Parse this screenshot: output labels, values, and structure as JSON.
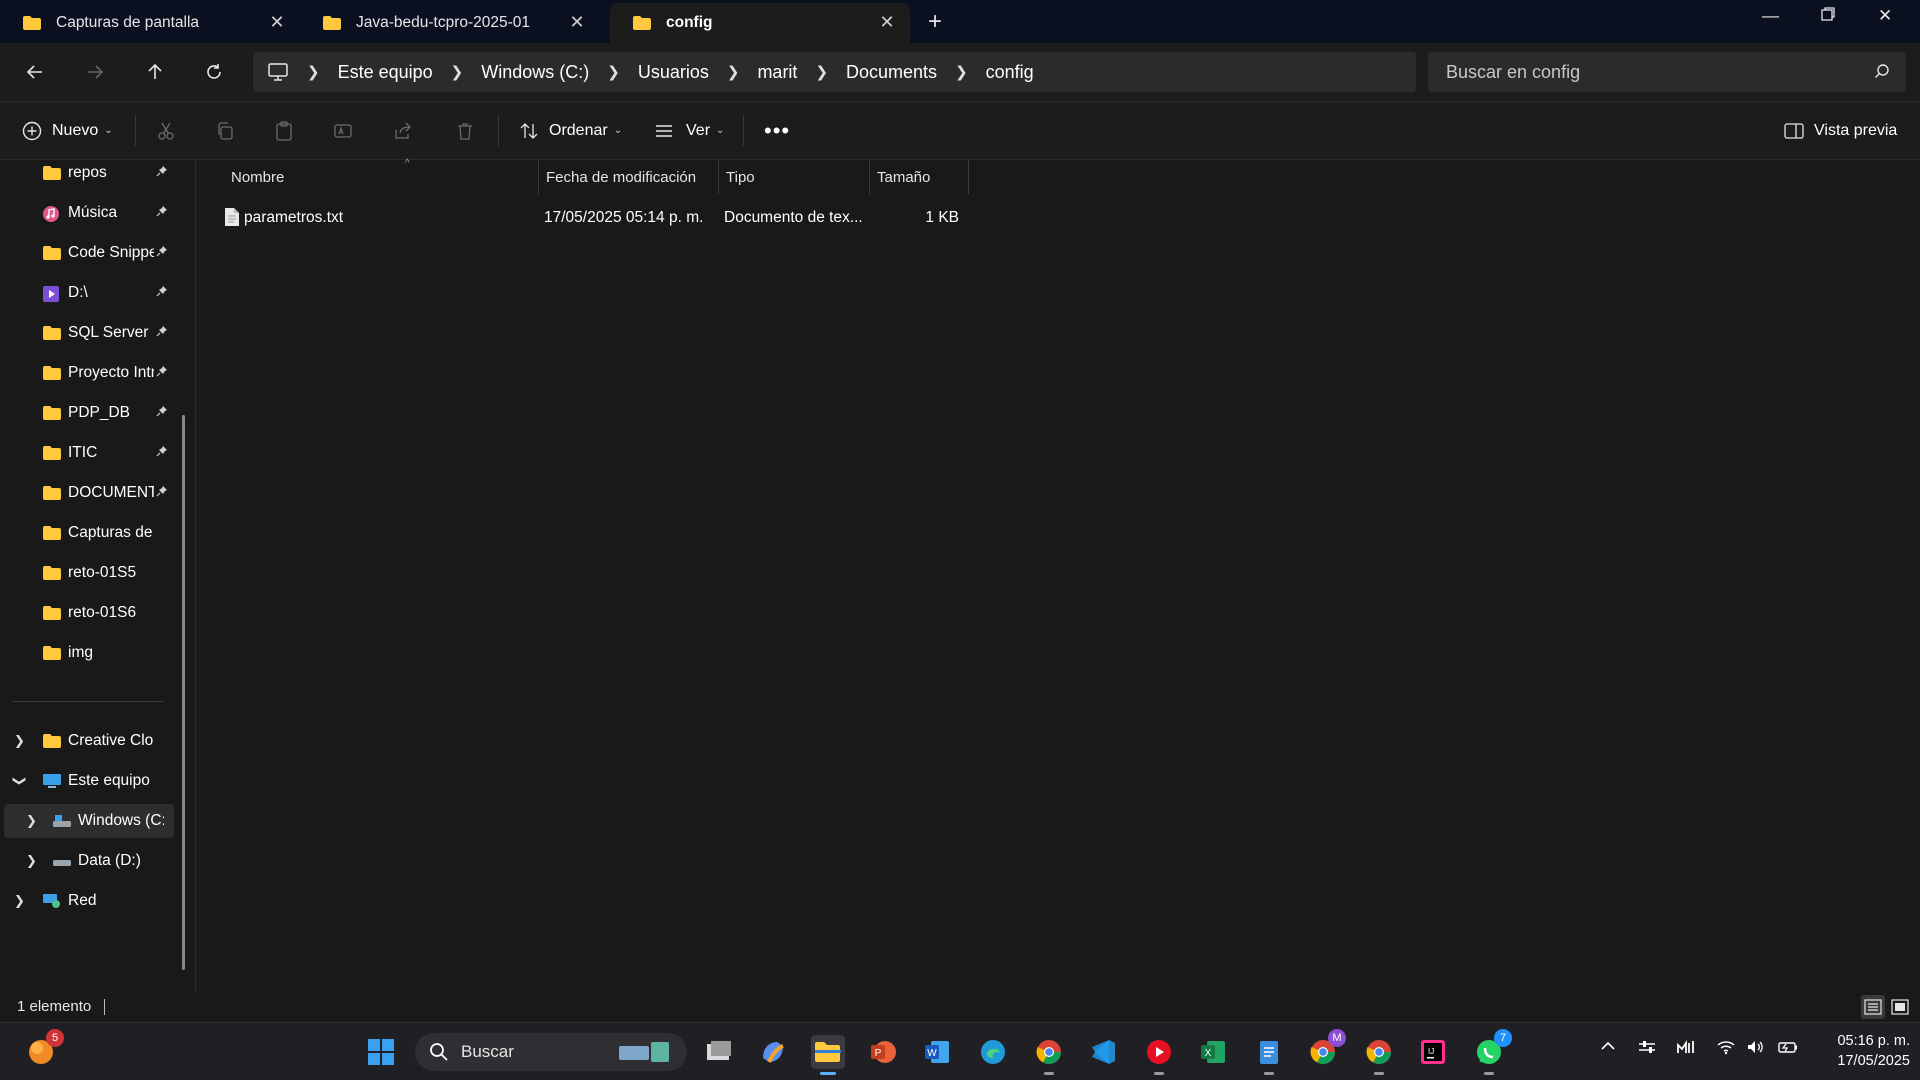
{
  "tabs": [
    {
      "label": "Capturas de pantalla"
    },
    {
      "label": "Java-bedu-tcpro-2025-01"
    },
    {
      "label": "config"
    }
  ],
  "breadcrumb": [
    "Este equipo",
    "Windows (C:)",
    "Usuarios",
    "marit",
    "Documents",
    "config"
  ],
  "search": {
    "placeholder": "Buscar en config"
  },
  "toolbar": {
    "new_label": "Nuevo",
    "sort_label": "Ordenar",
    "view_label": "Ver",
    "preview_label": "Vista previa"
  },
  "sidebar": {
    "quick_access": [
      {
        "label": "repos",
        "icon": "folder-icon",
        "pinned": true
      },
      {
        "label": "Música",
        "icon": "music-icon",
        "pinned": true
      },
      {
        "label": "Code Snippe",
        "icon": "folder-icon",
        "pinned": true
      },
      {
        "label": "D:\\",
        "icon": "video-drive-icon",
        "pinned": true
      },
      {
        "label": "SQL Server M",
        "icon": "folder-icon",
        "pinned": true
      },
      {
        "label": "Proyecto Intr",
        "icon": "folder-icon",
        "pinned": true
      },
      {
        "label": "PDP_DB",
        "icon": "folder-icon",
        "pinned": true
      },
      {
        "label": "ITIC",
        "icon": "folder-icon",
        "pinned": true
      },
      {
        "label": "DOCUMENTO",
        "icon": "folder-icon",
        "pinned": true
      },
      {
        "label": "Capturas de par",
        "icon": "folder-icon",
        "pinned": false
      },
      {
        "label": "reto-01S5",
        "icon": "folder-icon",
        "pinned": false
      },
      {
        "label": "reto-01S6",
        "icon": "folder-icon",
        "pinned": false
      },
      {
        "label": "img",
        "icon": "folder-icon",
        "pinned": false
      }
    ],
    "tree": [
      {
        "label": "Creative Cloud F"
      },
      {
        "label": "Este equipo"
      },
      {
        "label": "Windows (C:)"
      },
      {
        "label": "Data (D:)"
      },
      {
        "label": "Red"
      }
    ]
  },
  "columns": [
    "Nombre",
    "Fecha de modificación",
    "Tipo",
    "Tamaño"
  ],
  "files": [
    {
      "name": "parametros.txt",
      "modified": "17/05/2025 05:14 p. m.",
      "type": "Documento de tex...",
      "size": "1 KB"
    }
  ],
  "status": {
    "count": "1 elemento"
  },
  "taskbar": {
    "search_label": "Buscar",
    "badges": {
      "widgets": "5",
      "chrome_profile": "M",
      "whatsapp": "7"
    },
    "clock_time": "05:16 p. m.",
    "clock_date": "17/05/2025"
  },
  "colors": {
    "accent": "#ffc83d",
    "selected": "#2d2d2d",
    "background": "#191919"
  }
}
